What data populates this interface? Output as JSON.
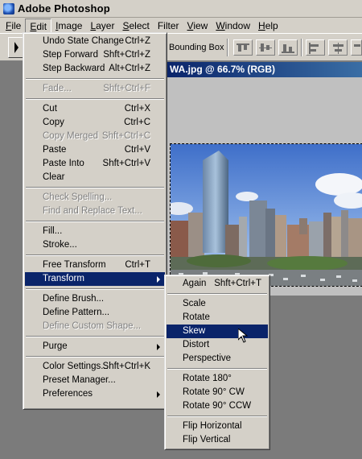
{
  "app": {
    "title": "Adobe Photoshop"
  },
  "menubar": [
    {
      "label": "File",
      "ul": "F",
      "rest": "ile"
    },
    {
      "label": "Edit",
      "ul": "E",
      "rest": "dit"
    },
    {
      "label": "Image",
      "ul": "I",
      "rest": "mage"
    },
    {
      "label": "Layer",
      "ul": "L",
      "rest": "ayer"
    },
    {
      "label": "Select",
      "ul": "S",
      "rest": "elect"
    },
    {
      "label": "Filter",
      "ul": "",
      "rest": "Filter"
    },
    {
      "label": "View",
      "ul": "V",
      "rest": "iew"
    },
    {
      "label": "Window",
      "ul": "W",
      "rest": "indow"
    },
    {
      "label": "Help",
      "ul": "H",
      "rest": "elp"
    }
  ],
  "options": {
    "bounding_box_label": "Bounding Box"
  },
  "document": {
    "title": "WA.jpg @ 66.7% (RGB)"
  },
  "edit_menu": {
    "undo": {
      "label": "Undo State Change",
      "shortcut": "Ctrl+Z"
    },
    "step_forward": {
      "label": "Step Forward",
      "shortcut": "Shft+Ctrl+Z"
    },
    "step_backward": {
      "label": "Step Backward",
      "shortcut": "Alt+Ctrl+Z"
    },
    "fade": {
      "label": "Fade...",
      "shortcut": "Shft+Ctrl+F"
    },
    "cut": {
      "label": "Cut",
      "shortcut": "Ctrl+X"
    },
    "copy": {
      "label": "Copy",
      "shortcut": "Ctrl+C"
    },
    "copy_merged": {
      "label": "Copy Merged",
      "shortcut": "Shft+Ctrl+C"
    },
    "paste": {
      "label": "Paste",
      "shortcut": "Ctrl+V"
    },
    "paste_into": {
      "label": "Paste Into",
      "shortcut": "Shft+Ctrl+V"
    },
    "clear": {
      "label": "Clear"
    },
    "check_spelling": {
      "label": "Check Spelling..."
    },
    "find_replace": {
      "label": "Find and Replace Text..."
    },
    "fill": {
      "label": "Fill..."
    },
    "stroke": {
      "label": "Stroke..."
    },
    "free_transform": {
      "label": "Free Transform",
      "shortcut": "Ctrl+T"
    },
    "transform": {
      "label": "Transform"
    },
    "define_brush": {
      "label": "Define Brush..."
    },
    "define_pattern": {
      "label": "Define Pattern..."
    },
    "define_custom_shape": {
      "label": "Define Custom Shape..."
    },
    "purge": {
      "label": "Purge"
    },
    "color_settings": {
      "label": "Color Settings...",
      "shortcut": "Shft+Ctrl+K"
    },
    "preset_manager": {
      "label": "Preset Manager..."
    },
    "preferences": {
      "label": "Preferences"
    }
  },
  "transform_menu": {
    "again": {
      "label": "Again",
      "shortcut": "Shft+Ctrl+T"
    },
    "scale": {
      "label": "Scale"
    },
    "rotate": {
      "label": "Rotate"
    },
    "skew": {
      "label": "Skew"
    },
    "distort": {
      "label": "Distort"
    },
    "perspective": {
      "label": "Perspective"
    },
    "rotate_180": {
      "label": "Rotate 180°"
    },
    "rotate_90_cw": {
      "label": "Rotate 90° CW"
    },
    "rotate_90_ccw": {
      "label": "Rotate 90° CCW"
    },
    "flip_horizontal": {
      "label": "Flip Horizontal"
    },
    "flip_vertical": {
      "label": "Flip Vertical"
    }
  },
  "colors": {
    "menu_bg": "#d4d0c8",
    "highlight": "#0a246a",
    "workspace": "#7b7b7b",
    "doc_title_start": "#0a246a",
    "doc_title_end": "#3a6ea5"
  }
}
